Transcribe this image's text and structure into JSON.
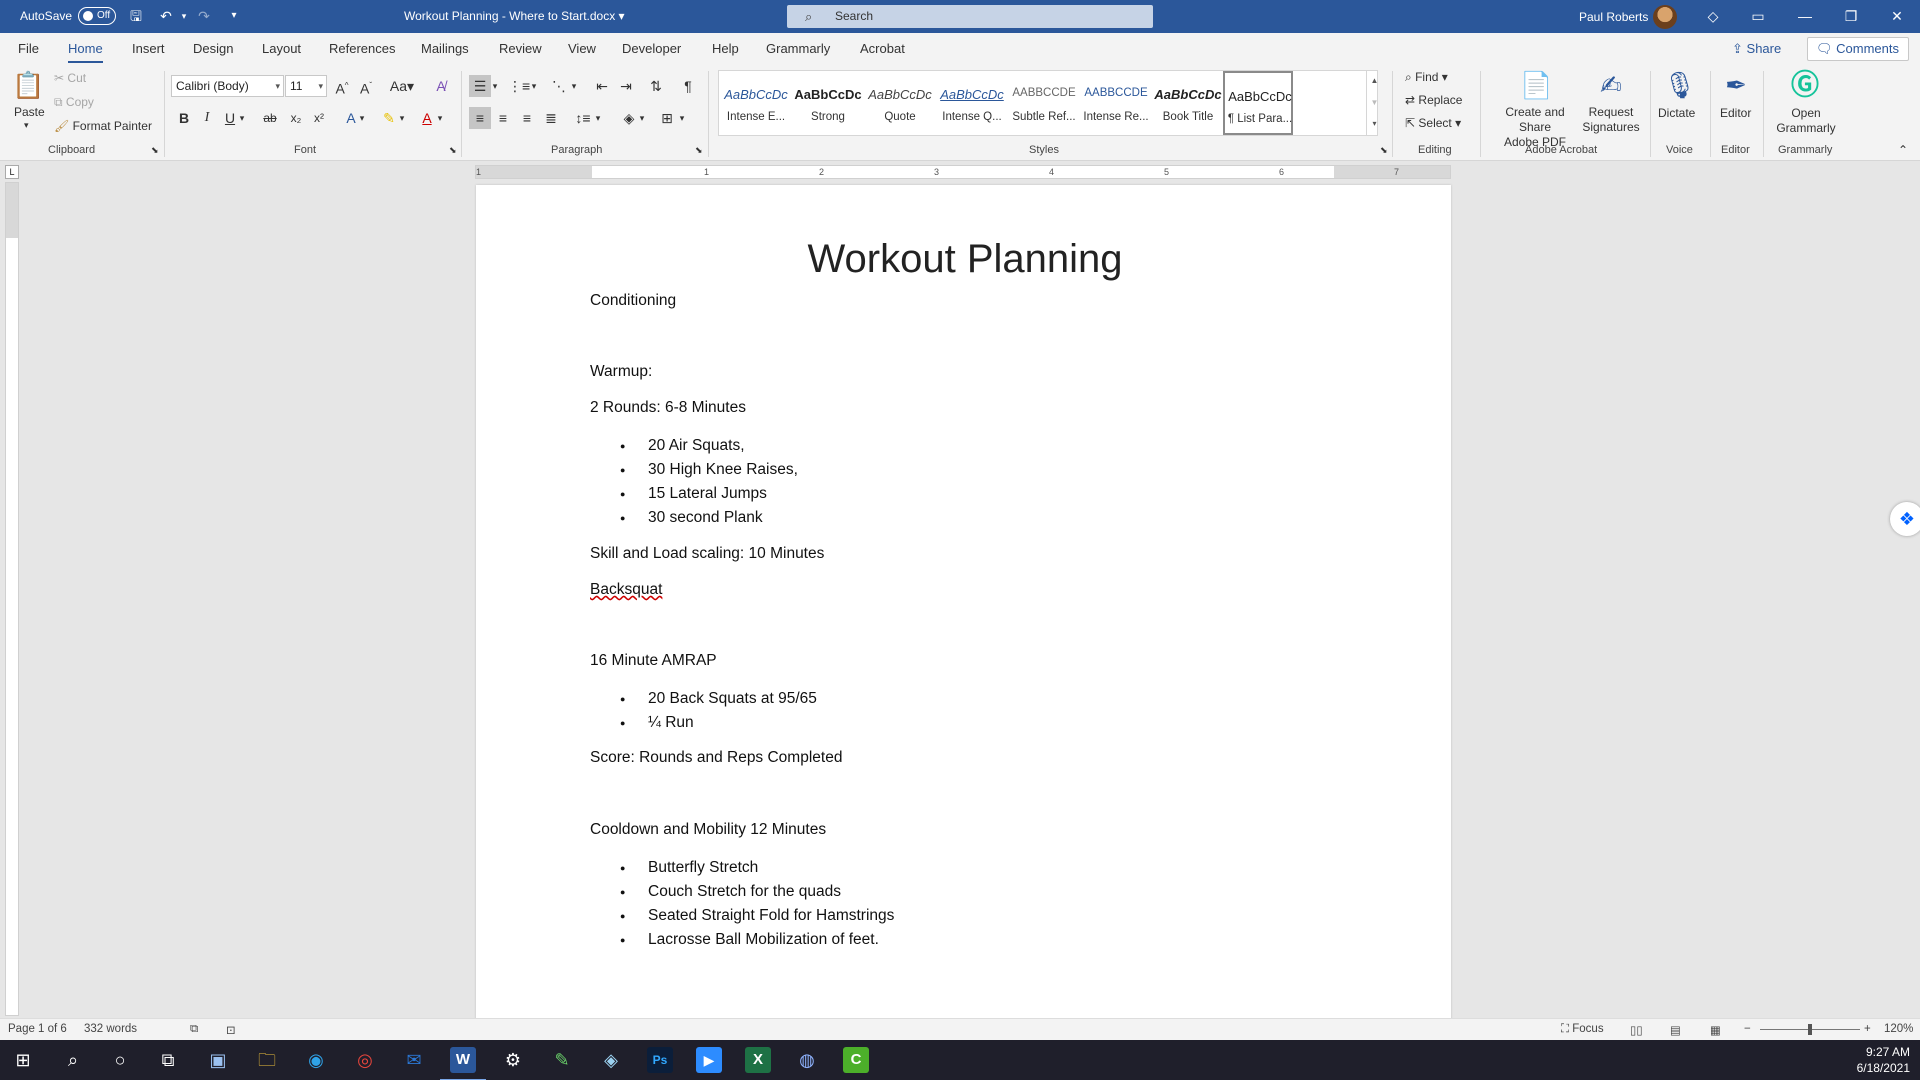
{
  "titlebar": {
    "autosave_label": "AutoSave",
    "autosave_state": "Off",
    "document_title": "Workout Planning - Where to Start.docx",
    "search_placeholder": "Search",
    "user_name": "Paul Roberts"
  },
  "tabs": [
    "File",
    "Home",
    "Insert",
    "Design",
    "Layout",
    "References",
    "Mailings",
    "Review",
    "View",
    "Developer",
    "Help",
    "Grammarly",
    "Acrobat"
  ],
  "active_tab": "Home",
  "share_label": "Share",
  "comments_label": "Comments",
  "clipboard": {
    "paste": "Paste",
    "cut": "Cut",
    "copy": "Copy",
    "format_painter": "Format Painter",
    "label": "Clipboard"
  },
  "font": {
    "family": "Calibri (Body)",
    "size": "11",
    "label": "Font"
  },
  "paragraph_label": "Paragraph",
  "styles": {
    "label": "Styles",
    "items": [
      {
        "sample": "AaBbCcDc",
        "name": "Intense E..."
      },
      {
        "sample": "AaBbCcDc",
        "name": "Strong"
      },
      {
        "sample": "AaBbCcDc",
        "name": "Quote"
      },
      {
        "sample": "AaBbCcDc",
        "name": "Intense Q..."
      },
      {
        "sample": "AABBCCDE",
        "name": "Subtle Ref..."
      },
      {
        "sample": "AABBCCDE",
        "name": "Intense Re..."
      },
      {
        "sample": "AaBbCcDc",
        "name": "Book Title"
      },
      {
        "sample": "AaBbCcDc",
        "name": "¶ List Para..."
      }
    ]
  },
  "editing": {
    "find": "Find",
    "replace": "Replace",
    "select": "Select",
    "label": "Editing"
  },
  "acrobat": {
    "create_share_line1": "Create and Share",
    "create_share_line2": "Adobe PDF",
    "request_line1": "Request",
    "request_line2": "Signatures",
    "label": "Adobe Acrobat"
  },
  "voice": {
    "dictate": "Dictate",
    "label": "Voice"
  },
  "editor": {
    "button": "Editor",
    "label": "Editor"
  },
  "grammarly": {
    "line1": "Open",
    "line2": "Grammarly",
    "label": "Grammarly"
  },
  "ruler_numbers": [
    "1",
    "1",
    "2",
    "3",
    "4",
    "5",
    "6",
    "7"
  ],
  "document": {
    "title": "Workout Planning",
    "conditioning": "Conditioning",
    "warmup": "Warmup:",
    "warmup_rounds": "2 Rounds: 6-8 Minutes",
    "warmup_items": [
      "20 Air Squats,",
      "30 High Knee Raises,",
      "15 Lateral Jumps",
      "30 second Plank"
    ],
    "skill": "Skill and Load scaling: 10 Minutes",
    "backsquat": "Backsquat",
    "amrap": "16 Minute AMRAP",
    "amrap_items": [
      "20 Back Squats at 95/65",
      "¼ Run"
    ],
    "score": "Score: Rounds and Reps Completed",
    "cooldown": "Cooldown and Mobility 12 Minutes",
    "cooldown_items": [
      "Butterfly Stretch",
      "Couch Stretch for the quads",
      "Seated Straight Fold for Hamstrings",
      "Lacrosse Ball Mobilization of feet."
    ]
  },
  "statusbar": {
    "page": "Page 1 of 6",
    "words": "332 words",
    "focus": "Focus",
    "zoom": "120%"
  },
  "clock": {
    "time": "9:27 AM",
    "date": "6/18/2021"
  }
}
